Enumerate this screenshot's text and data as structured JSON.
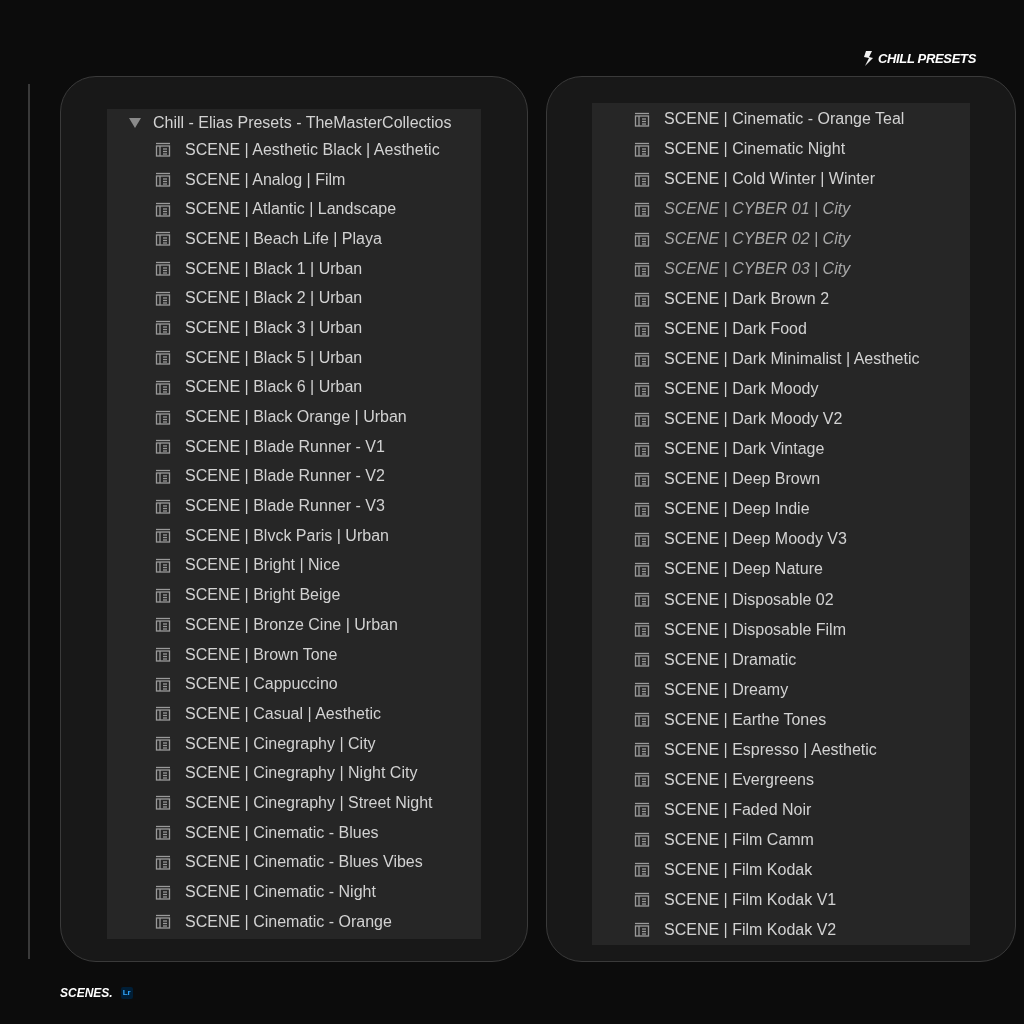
{
  "brand": {
    "title": "CHILL PRESETS"
  },
  "left_panel": {
    "folder": {
      "label": "Chill - Elias Presets - TheMasterCollectios",
      "expanded": true
    },
    "presets": [
      {
        "label": "SCENE | Aesthetic Black | Aesthetic",
        "kind": "regular"
      },
      {
        "label": "SCENE | Analog | Film",
        "kind": "regular"
      },
      {
        "label": "SCENE | Atlantic | Landscape",
        "kind": "regular"
      },
      {
        "label": "SCENE | Beach Life | Playa",
        "kind": "regular"
      },
      {
        "label": "SCENE | Black 1 | Urban",
        "kind": "regular"
      },
      {
        "label": "SCENE | Black 2 | Urban",
        "kind": "regular"
      },
      {
        "label": "SCENE | Black 3 | Urban",
        "kind": "regular"
      },
      {
        "label": "SCENE | Black 5 | Urban",
        "kind": "regular"
      },
      {
        "label": "SCENE | Black 6 | Urban",
        "kind": "regular"
      },
      {
        "label": "SCENE | Black Orange | Urban",
        "kind": "regular"
      },
      {
        "label": "SCENE | Blade Runner - V1",
        "kind": "regular"
      },
      {
        "label": "SCENE | Blade Runner - V2",
        "kind": "regular"
      },
      {
        "label": "SCENE | Blade Runner - V3",
        "kind": "regular"
      },
      {
        "label": "SCENE | Blvck Paris | Urban",
        "kind": "regular"
      },
      {
        "label": "SCENE | Bright | Nice",
        "kind": "regular"
      },
      {
        "label": "SCENE | Bright Beige",
        "kind": "regular"
      },
      {
        "label": "SCENE | Bronze Cine | Urban",
        "kind": "regular"
      },
      {
        "label": "SCENE | Brown Tone",
        "kind": "regular"
      },
      {
        "label": "SCENE | Cappuccino",
        "kind": "regular"
      },
      {
        "label": "SCENE | Casual | Aesthetic",
        "kind": "regular"
      },
      {
        "label": "SCENE | Cinegraphy | City",
        "kind": "regular"
      },
      {
        "label": "SCENE | Cinegraphy | Night City",
        "kind": "regular"
      },
      {
        "label": "SCENE | Cinegraphy | Street Night",
        "kind": "regular"
      },
      {
        "label": "SCENE | Cinematic - Blues",
        "kind": "regular"
      },
      {
        "label": "SCENE | Cinematic - Blues Vibes",
        "kind": "regular"
      },
      {
        "label": "SCENE | Cinematic - Night",
        "kind": "regular"
      },
      {
        "label": "SCENE | Cinematic - Orange",
        "kind": "regular"
      }
    ]
  },
  "right_panel": {
    "presets": [
      {
        "label": "SCENE | Cinematic - Orange Teal",
        "kind": "regular"
      },
      {
        "label": "SCENE | Cinematic Night",
        "kind": "regular"
      },
      {
        "label": "SCENE | Cold Winter | Winter",
        "kind": "regular"
      },
      {
        "label": "SCENE | CYBER 01 | City",
        "kind": "italic"
      },
      {
        "label": "SCENE | CYBER 02 | City",
        "kind": "italic"
      },
      {
        "label": "SCENE | CYBER 03 | City",
        "kind": "italic"
      },
      {
        "label": "SCENE | Dark Brown 2",
        "kind": "regular"
      },
      {
        "label": "SCENE | Dark Food",
        "kind": "regular"
      },
      {
        "label": "SCENE | Dark Minimalist | Aesthetic",
        "kind": "regular"
      },
      {
        "label": "SCENE | Dark Moody",
        "kind": "regular"
      },
      {
        "label": "SCENE | Dark Moody V2",
        "kind": "regular"
      },
      {
        "label": "SCENE | Dark Vintage",
        "kind": "regular"
      },
      {
        "label": "SCENE | Deep Brown",
        "kind": "regular"
      },
      {
        "label": "SCENE | Deep Indie",
        "kind": "regular"
      },
      {
        "label": "SCENE | Deep Moody V3",
        "kind": "regular"
      },
      {
        "label": "SCENE | Deep Nature",
        "kind": "regular"
      },
      {
        "label": "SCENE | Disposable 02",
        "kind": "regular"
      },
      {
        "label": "SCENE | Disposable Film",
        "kind": "regular"
      },
      {
        "label": "SCENE | Dramatic",
        "kind": "regular"
      },
      {
        "label": "SCENE | Dreamy",
        "kind": "regular"
      },
      {
        "label": "SCENE | Earthe Tones",
        "kind": "regular"
      },
      {
        "label": "SCENE | Espresso | Aesthetic",
        "kind": "regular"
      },
      {
        "label": "SCENE | Evergreens",
        "kind": "regular"
      },
      {
        "label": "SCENE | Faded Noir",
        "kind": "regular"
      },
      {
        "label": "SCENE | Film Camm",
        "kind": "regular"
      },
      {
        "label": "SCENE | Film Kodak",
        "kind": "regular"
      },
      {
        "label": "SCENE | Film Kodak V1",
        "kind": "regular"
      },
      {
        "label": "SCENE | Film Kodak V2",
        "kind": "regular"
      }
    ]
  },
  "footer": {
    "title": "SCENES.",
    "badge": "Lr"
  }
}
